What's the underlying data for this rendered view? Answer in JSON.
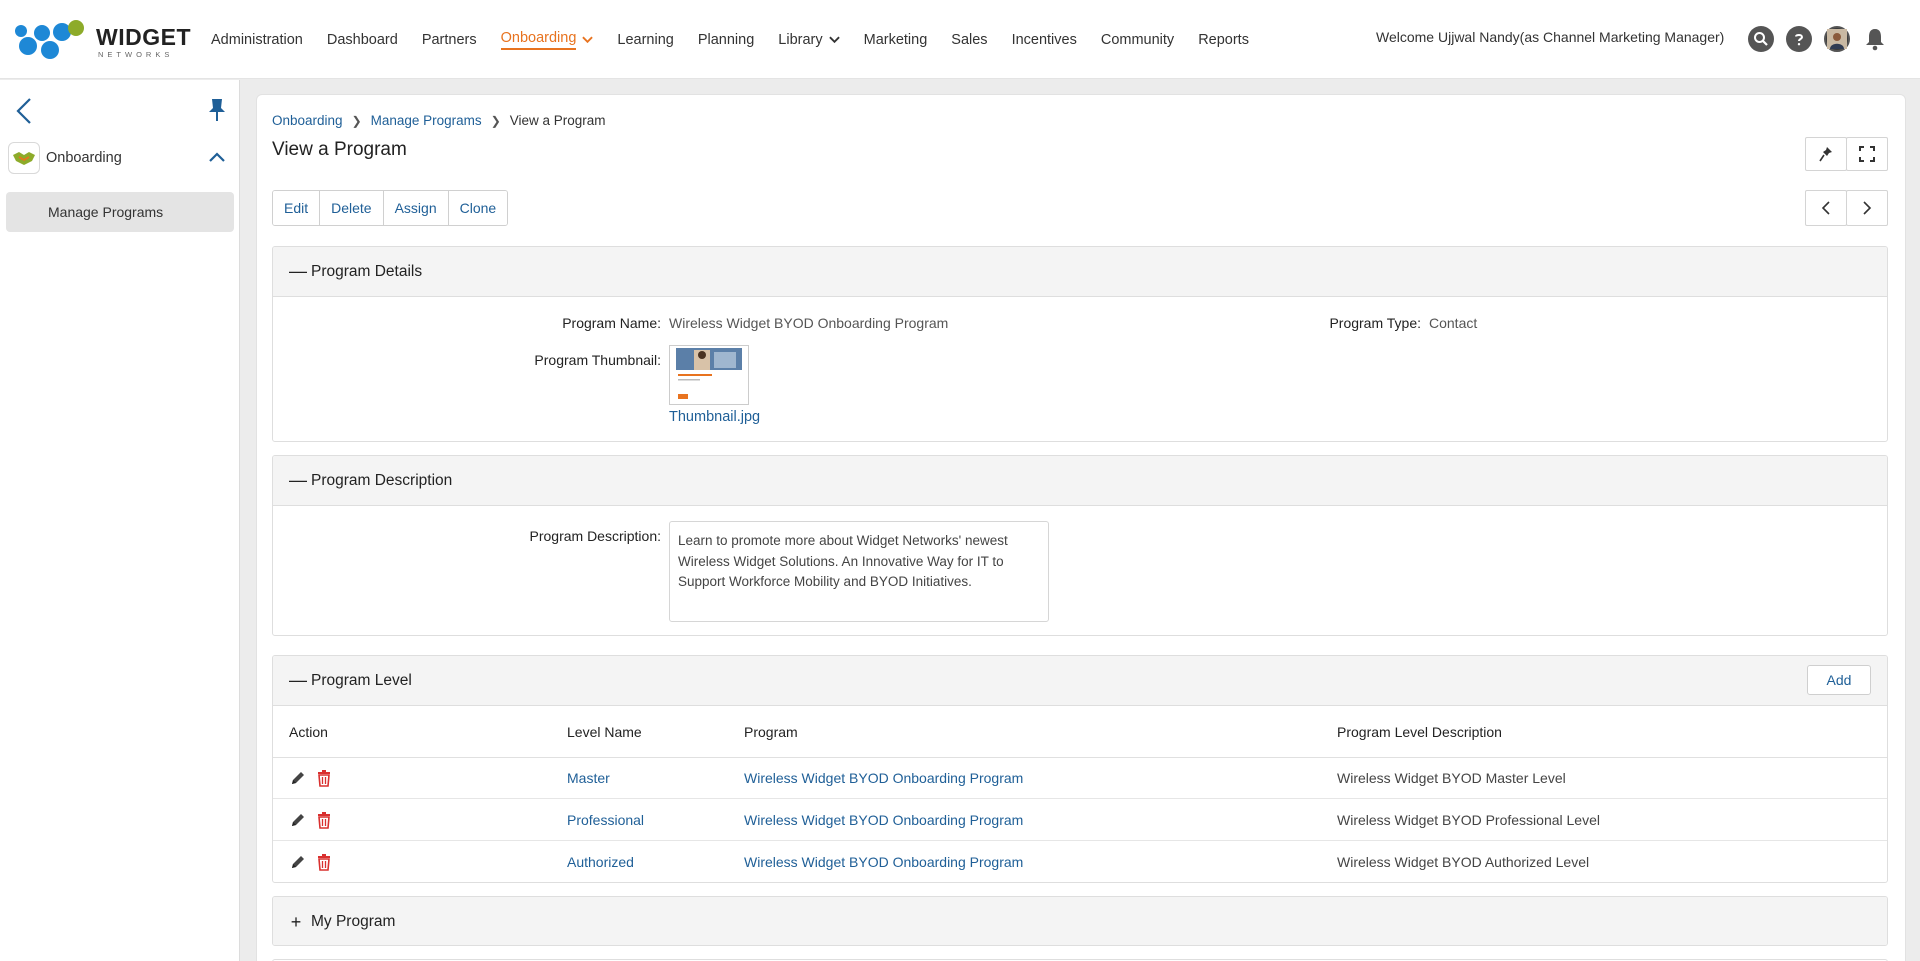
{
  "brand": {
    "name": "WIDGET",
    "tagline": "NETWORKS"
  },
  "nav": {
    "items": [
      {
        "label": "Administration"
      },
      {
        "label": "Dashboard"
      },
      {
        "label": "Partners"
      },
      {
        "label": "Onboarding",
        "active": true,
        "dropdown": true
      },
      {
        "label": "Learning"
      },
      {
        "label": "Planning"
      },
      {
        "label": "Library",
        "dropdown": true
      },
      {
        "label": "Marketing"
      },
      {
        "label": "Sales"
      },
      {
        "label": "Incentives"
      },
      {
        "label": "Community"
      },
      {
        "label": "Reports"
      }
    ],
    "welcome": "Welcome Ujjwal Nandy(as Channel Marketing Manager)",
    "icons": [
      "search-icon",
      "help-icon",
      "avatar",
      "bell-icon"
    ]
  },
  "sidebar": {
    "module_label": "Onboarding",
    "items": [
      {
        "label": "Manage Programs",
        "active": true
      }
    ]
  },
  "breadcrumb": {
    "items": [
      "Onboarding",
      "Manage Programs"
    ],
    "current": "View a Program"
  },
  "page_title": "View a Program",
  "actions": {
    "edit": "Edit",
    "delete": "Delete",
    "assign": "Assign",
    "clone": "Clone"
  },
  "details": {
    "title": "Program Details",
    "name_label": "Program Name:",
    "name_value": "Wireless Widget BYOD Onboarding Program",
    "type_label": "Program Type:",
    "type_value": "Contact",
    "thumb_label": "Program Thumbnail:",
    "thumb_file": "Thumbnail.jpg"
  },
  "description": {
    "title": "Program Description",
    "label": "Program Description:",
    "text": "Learn to promote more about Widget Networks' newest Wireless Widget Solutions. An Innovative Way for IT to Support Workforce Mobility and BYOD Initiatives."
  },
  "levels": {
    "title": "Program Level",
    "add_label": "Add",
    "columns": {
      "action": "Action",
      "level": "Level Name",
      "program": "Program",
      "desc": "Program Level Description"
    },
    "rows": [
      {
        "level": "Master",
        "program": "Wireless Widget BYOD Onboarding Program",
        "desc": "Wireless Widget BYOD Master Level"
      },
      {
        "level": "Professional",
        "program": "Wireless Widget BYOD Onboarding Program",
        "desc": "Wireless Widget BYOD Professional Level"
      },
      {
        "level": "Authorized",
        "program": "Wireless Widget BYOD Onboarding Program",
        "desc": "Wireless Widget BYOD Authorized Level"
      }
    ]
  },
  "my_program": {
    "title": "My Program"
  },
  "colors": {
    "accent": "#e8731f",
    "link": "#1f5f97",
    "brand_blue": "#1e88d6",
    "brand_green": "#8dab2a",
    "delete": "#d9302f"
  }
}
